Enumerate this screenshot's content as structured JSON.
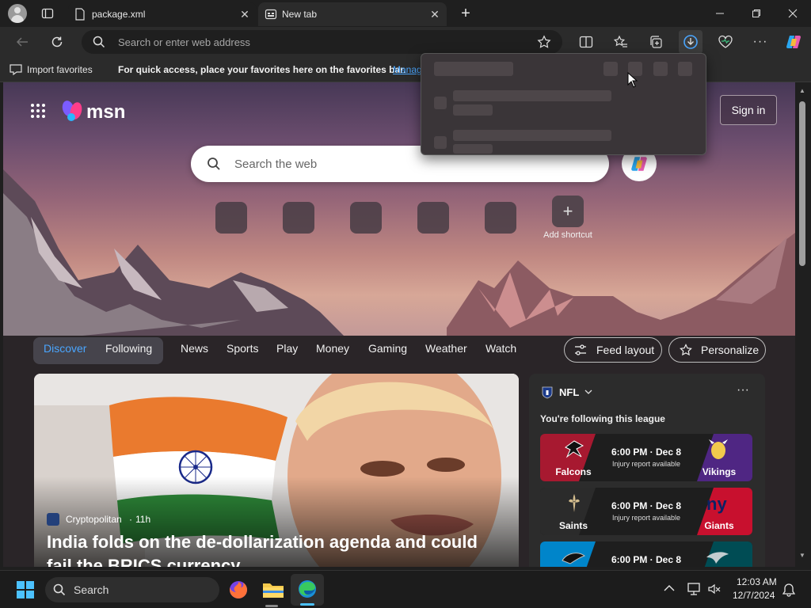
{
  "browser": {
    "tabs": [
      {
        "label": "package.xml",
        "active": false
      },
      {
        "label": "New tab",
        "active": true
      }
    ],
    "address_placeholder": "Search or enter web address",
    "favorites_bar": {
      "import_label": "Import favorites",
      "message": "For quick access, place your favorites here on the favorites bar.",
      "manage_link": "Manag"
    }
  },
  "msn": {
    "brand": "msn",
    "sign_in": "Sign in",
    "search_placeholder": "Search the web",
    "add_shortcut": "Add shortcut",
    "feed_tabs": {
      "discover": "Discover",
      "following": "Following"
    },
    "nav_items": [
      "News",
      "Sports",
      "Play",
      "Money",
      "Gaming",
      "Weather",
      "Watch"
    ],
    "feed_layout": "Feed layout",
    "personalize": "Personalize",
    "hero": {
      "source": "Cryptopolitan",
      "age": "11h",
      "headline_line1": "India folds on the de-dollarization agenda and could",
      "headline_line2": "fail the BRICS currency"
    },
    "nfl": {
      "title": "NFL",
      "subtitle": "You're following this league",
      "games": [
        {
          "time": "6:00 PM · Dec 8",
          "note": "Injury report available",
          "home": "Falcons",
          "away": "Vikings",
          "home_color": "#a71930",
          "away_color": "#4f2683"
        },
        {
          "time": "6:00 PM · Dec 8",
          "note": "Injury report available",
          "home": "Saints",
          "away": "Giants",
          "home_color": "#2b2b2b",
          "away_color": "#c8102e"
        },
        {
          "time": "6:00 PM · Dec 8",
          "note": "",
          "home": "Panthers",
          "away": "Eagles",
          "home_color": "#0085ca",
          "away_color": "#004c54"
        }
      ]
    }
  },
  "taskbar": {
    "search_label": "Search",
    "time": "12:03 AM",
    "date": "12/7/2024"
  },
  "colors": {
    "accent": "#0078d4",
    "discover_blue": "#4aa6ff",
    "link": "#4aa6ff"
  }
}
